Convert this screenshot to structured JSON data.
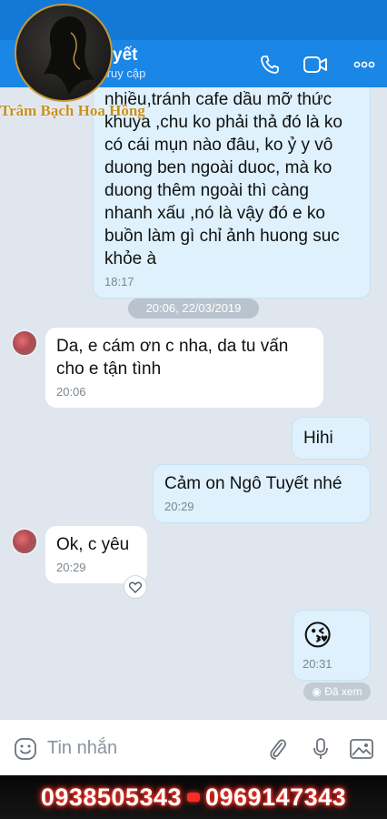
{
  "header": {
    "name": "Ngô Tuyết",
    "status": "Vừa mới truy cập"
  },
  "watermark": {
    "text": "Trâm Bạch Hoa Hồng"
  },
  "messages": [
    {
      "text": "nhiều,tránh cafe dầu mỡ thức khuya ,chu ko phải thả đó là ko có cái mụn nào đâu, ko ỷ y vô duong ben ngoài duoc, mà ko duong thêm ngoài thì càng nhanh xấu ,nó là vậy đó e ko buồn làm gì chỉ ảnh huong suc khỏe à",
      "time": "18:17"
    },
    {
      "text": "Da, e cám ơn c nha, da tu vấn cho e tận tình",
      "time": "20:06"
    },
    {
      "text": "Hihi",
      "time": ""
    },
    {
      "text": "Cảm on Ngô Tuyết nhé",
      "time": "20:29"
    },
    {
      "text": "Ok, c yêu",
      "time": "20:29"
    },
    {
      "text": "😘",
      "time": "20:31"
    }
  ],
  "date_separator": "20:06, 22/03/2019",
  "seen_label": "Đã xem",
  "composer": {
    "placeholder": "Tin nhắn"
  },
  "phones": {
    "phone1": "0938505343",
    "phone2": "0969147343"
  },
  "colors": {
    "header": "#1a86e6",
    "mine_bubble": "#def1fd",
    "phone_glow": "#ff3b2f"
  }
}
